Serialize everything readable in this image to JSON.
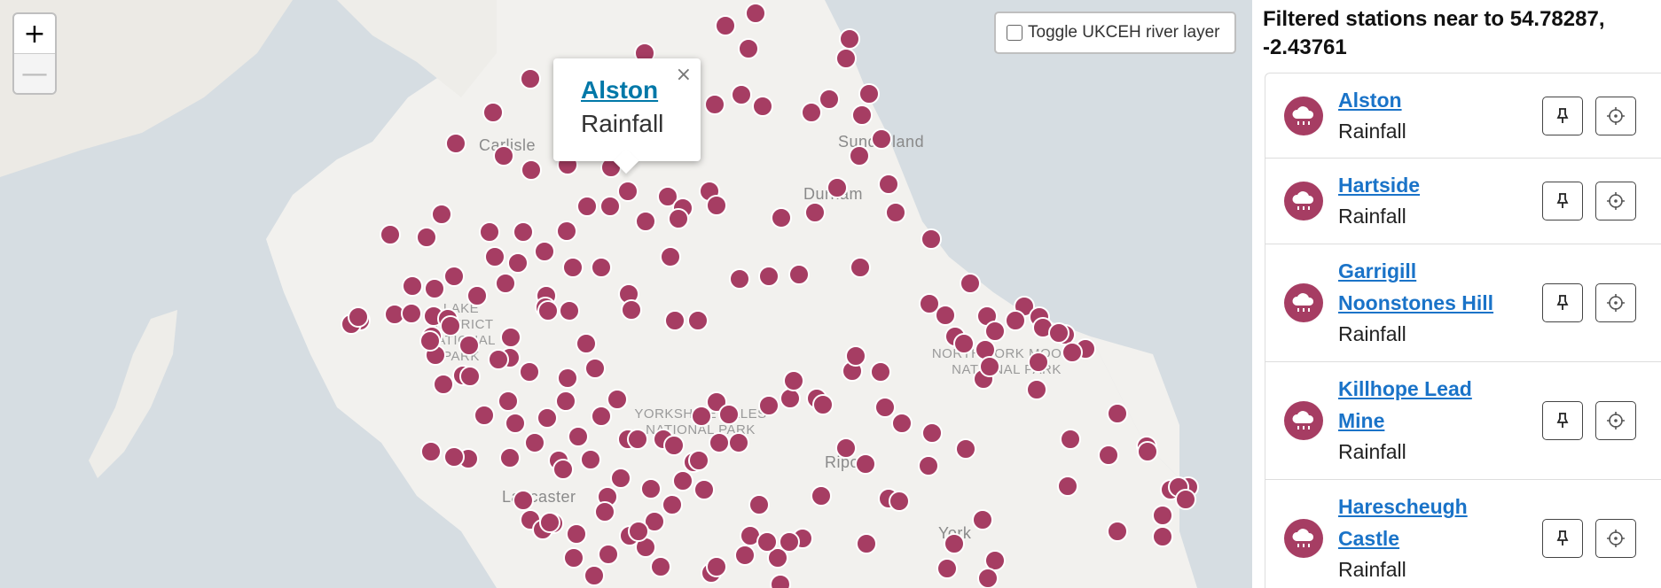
{
  "map": {
    "zoom_in_label": "+",
    "zoom_out_label": "—",
    "river_toggle_label": "Toggle UKCEH river layer",
    "river_toggle_checked": false,
    "marker_color": "#a63d63",
    "popup": {
      "name": "Alston",
      "type": "Rainfall",
      "close_label": "×"
    },
    "place_labels": {
      "carlisle": "Carlisle",
      "sunderland": "Sunderland",
      "durham": "Durham",
      "ripon": "Ripon",
      "lancaster": "Lancaster",
      "york": "York",
      "lake_district": "LAKE DISTRICT NATIONAL PARK",
      "yorkshire_dales": "YORKSHIRE DALES NATIONAL PARK",
      "north_york_moors": "NORTH YORK MOORS NATIONAL PARK"
    }
  },
  "panel": {
    "title": "Filtered stations near to 54.78287, -2.43761",
    "stations": [
      {
        "name": "Alston",
        "type": "Rainfall"
      },
      {
        "name": "Hartside",
        "type": "Rainfall"
      },
      {
        "name": "Garrigill Noonstones Hill",
        "type": "Rainfall"
      },
      {
        "name": "Killhope Lead Mine",
        "type": "Rainfall"
      },
      {
        "name": "Harescheugh Castle",
        "type": "Rainfall"
      }
    ],
    "icons": {
      "station": "rain-cloud-icon",
      "pin": "pin-icon",
      "locate": "crosshair-icon"
    }
  }
}
